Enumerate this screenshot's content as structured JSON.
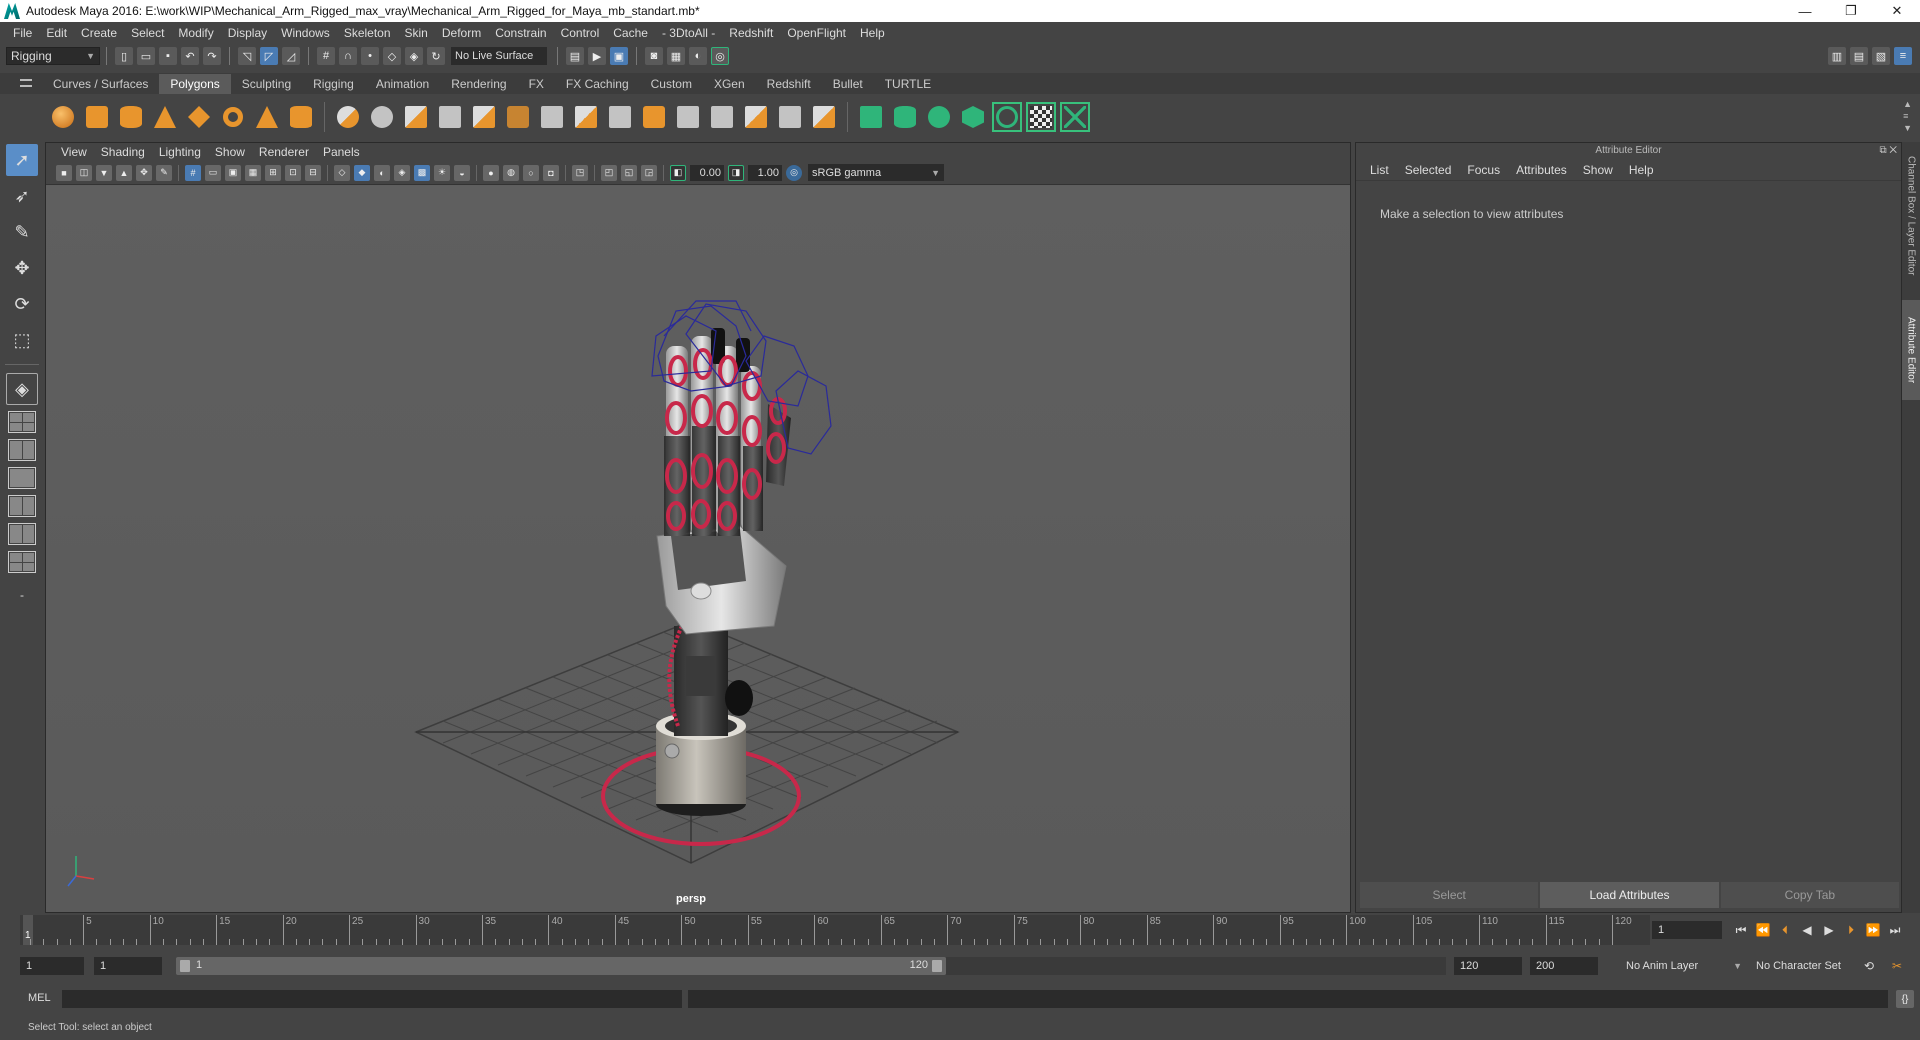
{
  "window": {
    "title": "Autodesk Maya 2016: E:\\work\\WIP\\Mechanical_Arm_Rigged_max_vray\\Mechanical_Arm_Rigged_for_Maya_mb_standart.mb*",
    "minimize": "—",
    "maximize": "❐",
    "close": "✕"
  },
  "menubar": [
    "File",
    "Edit",
    "Create",
    "Select",
    "Modify",
    "Display",
    "Windows",
    "Skeleton",
    "Skin",
    "Deform",
    "Constrain",
    "Control",
    "Cache",
    "- 3DtoAll -",
    "Redshift",
    "OpenFlight",
    "Help"
  ],
  "statusline": {
    "mode": "Rigging",
    "live_surface": "No Live Surface"
  },
  "shelf": {
    "tabs": [
      "Curves / Surfaces",
      "Polygons",
      "Sculpting",
      "Rigging",
      "Animation",
      "Rendering",
      "FX",
      "FX Caching",
      "Custom",
      "XGen",
      "Redshift",
      "Bullet",
      "TURTLE"
    ],
    "active_tab": "Polygons"
  },
  "viewport": {
    "menu": [
      "View",
      "Shading",
      "Lighting",
      "Show",
      "Renderer",
      "Panels"
    ],
    "exposure": "0.00",
    "gamma": "1.00",
    "color_space": "sRGB gamma",
    "camera": "persp"
  },
  "attribute_editor": {
    "title": "Attribute Editor",
    "menu": [
      "List",
      "Selected",
      "Focus",
      "Attributes",
      "Show",
      "Help"
    ],
    "message": "Make a selection to view attributes",
    "buttons": {
      "select": "Select",
      "load": "Load Attributes",
      "copy": "Copy Tab"
    }
  },
  "side_tabs": {
    "channel_box": "Channel Box / Layer Editor",
    "attribute_editor": "Attribute Editor"
  },
  "timeline": {
    "current_frame": "1",
    "tick_labels": [
      "5",
      "10",
      "15",
      "20",
      "25",
      "30",
      "35",
      "40",
      "45",
      "50",
      "55",
      "60",
      "65",
      "70",
      "75",
      "80",
      "85",
      "90",
      "95",
      "100",
      "105",
      "110",
      "115",
      "120"
    ],
    "current_frame_field": "1"
  },
  "range": {
    "start_time": "1",
    "playback_start": "1",
    "range_start": "1",
    "range_end": "120",
    "playback_end": "120",
    "end_time": "200",
    "anim_layer": "No Anim Layer",
    "character_set": "No Character Set"
  },
  "command_line": {
    "label": "MEL"
  },
  "help_line": {
    "text": "Select Tool: select an object"
  },
  "colors": {
    "accent": "#5a8ec8",
    "rig_red": "#c8284a",
    "rig_blue": "#2a2a9a",
    "shelf_poly": "#e8952d",
    "shelf_green": "#2fb57a"
  }
}
